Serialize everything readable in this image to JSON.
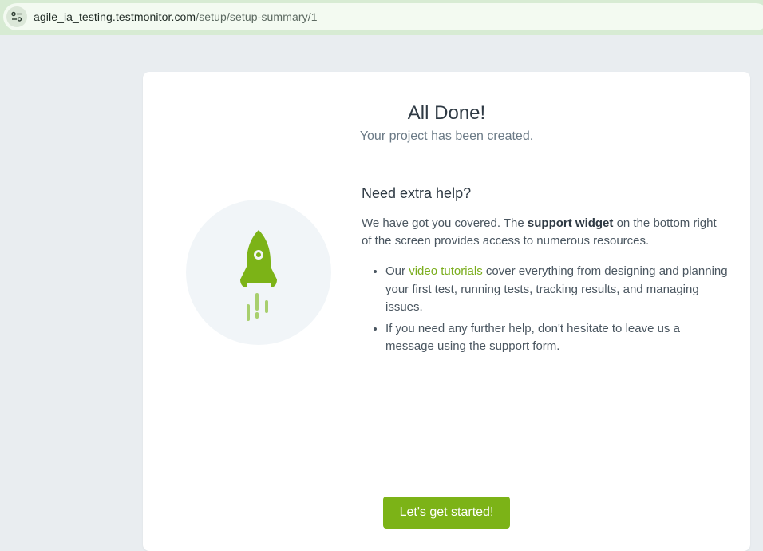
{
  "browser": {
    "url_host": "agile_ia_testing.testmonitor.com",
    "url_path": "/setup/setup-summary/1"
  },
  "card": {
    "title": "All Done!",
    "subtitle": "Your project has been created.",
    "help_title": "Need extra help?",
    "help_text_before": "We have got you covered. The ",
    "help_text_bold": "support widget",
    "help_text_after": " on the bottom right of the screen provides access to numerous resources.",
    "bullets": {
      "first_before": "Our ",
      "first_link": "video tutorials",
      "first_after": " cover everything from designing and planning your first test, running tests, tracking results, and managing issues.",
      "second": "If you need any further help, don't hesitate to leave us a message using the support form."
    },
    "button_label": "Let's get started!"
  },
  "colors": {
    "accent": "#7cb317",
    "link": "#7aad1c",
    "background": "#e9edf0"
  },
  "icons": {
    "site": "site-settings-icon",
    "illustration": "rocket-icon"
  }
}
